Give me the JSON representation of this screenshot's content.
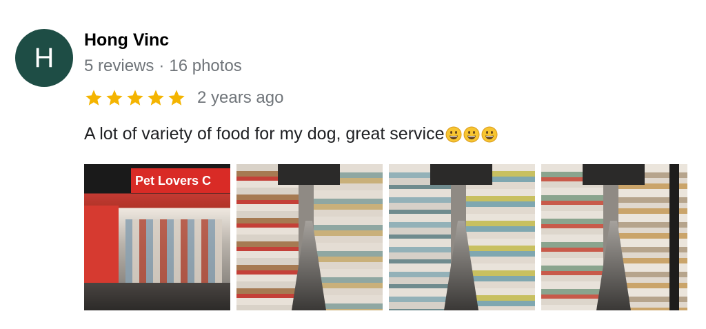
{
  "reviewer": {
    "initial": "H",
    "name": "Hong Vinc",
    "reviews": "5 reviews",
    "separator": "·",
    "photos_count": "16 photos",
    "avatar_color": "#1e4d45"
  },
  "rating": {
    "stars": 5,
    "max_stars": 5,
    "star_color": "#f4b400",
    "date": "2 years ago"
  },
  "review": {
    "text": "A lot of variety of food for my dog, great service",
    "emojis": [
      "grinning-face-emoji",
      "grinning-face-emoji",
      "grinning-face-emoji"
    ]
  },
  "photos": [
    {
      "name": "photo-store-front",
      "sign_text": "Pet Lovers C"
    },
    {
      "name": "photo-aisle-1"
    },
    {
      "name": "photo-aisle-2"
    },
    {
      "name": "photo-aisle-3"
    }
  ]
}
